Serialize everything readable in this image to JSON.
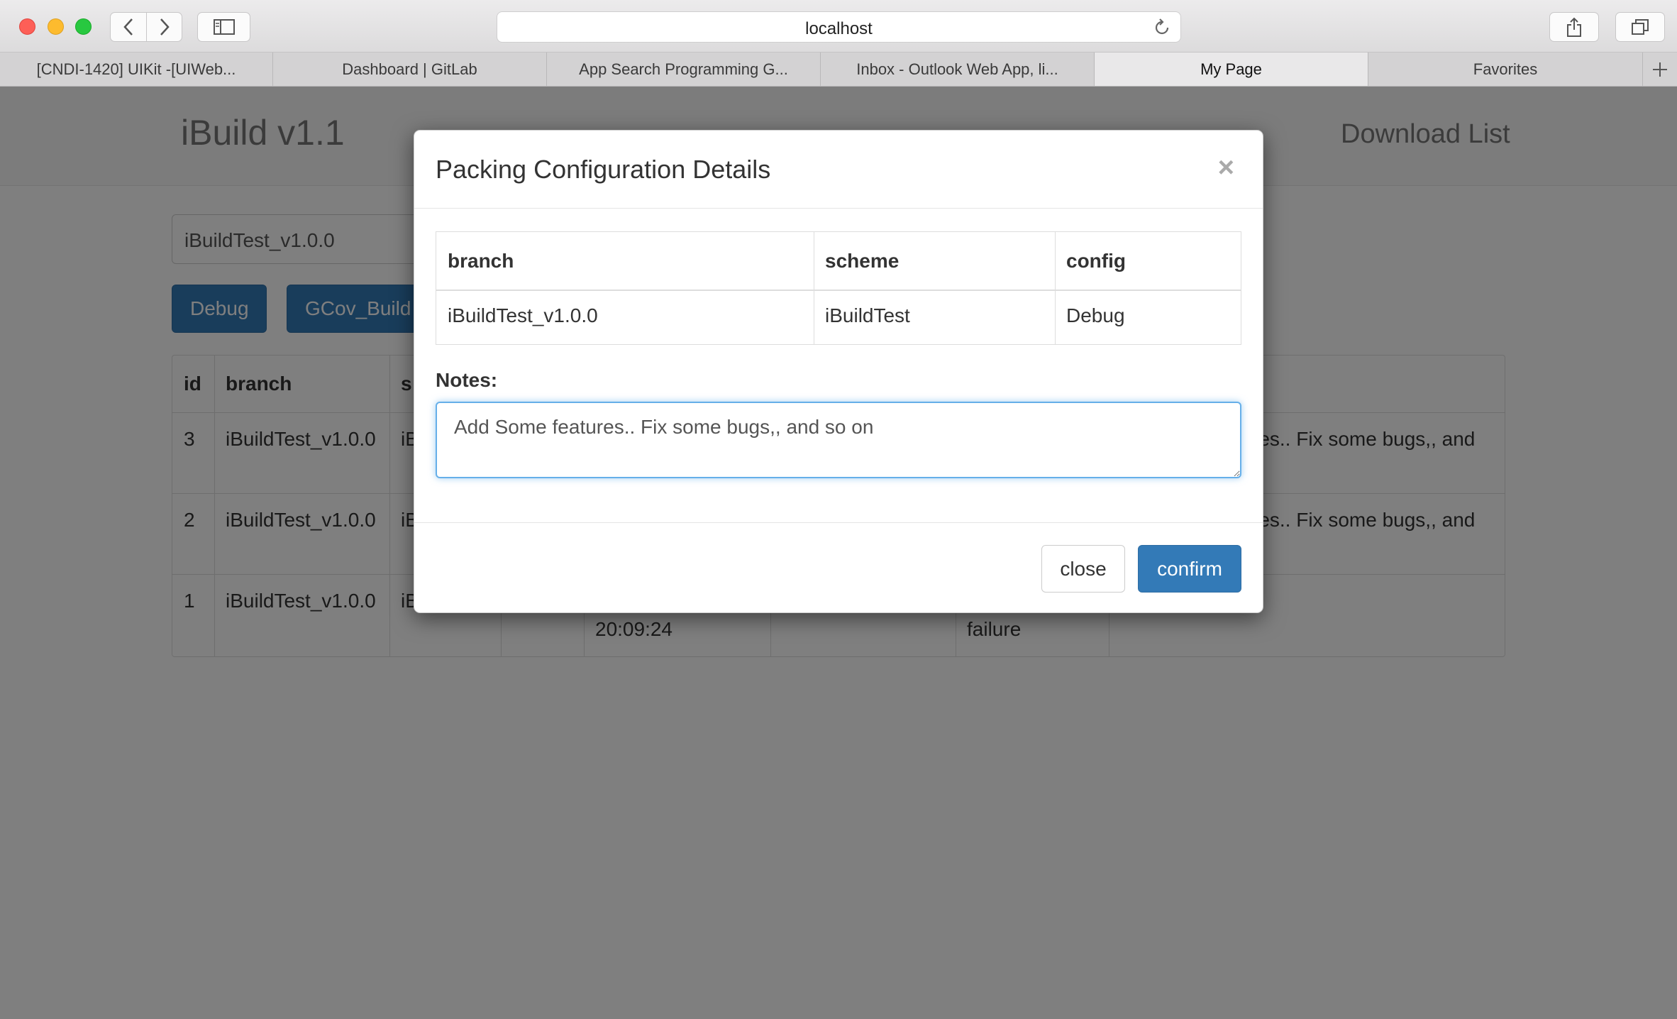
{
  "browser": {
    "url": "localhost",
    "tabs": [
      {
        "label": "[CNDI-1420] UIKit -[UIWeb..."
      },
      {
        "label": "Dashboard | GitLab"
      },
      {
        "label": "App Search Programming G..."
      },
      {
        "label": "Inbox - Outlook Web App, li..."
      },
      {
        "label": "My Page"
      },
      {
        "label": "Favorites"
      }
    ],
    "active_tab": "My Page"
  },
  "page": {
    "brand": "iBuild v1.1",
    "nav_link": "Download List",
    "branch_select_value": "iBuildTest_v1.0.0",
    "buttons": [
      "Debug",
      "GCov_Build"
    ],
    "table": {
      "headers": [
        "id",
        "branch",
        "s"
      ],
      "rows": [
        {
          "id": "3",
          "branch": "iBuildTest_v1.0.0",
          "scheme": "iB",
          "notes": "res.. Fix some bugs,, and"
        },
        {
          "id": "2",
          "branch": "iBuildTest_v1.0.0",
          "scheme": "iB",
          "notes": "res.. Fix some bugs,, and"
        },
        {
          "id": "1",
          "branch": "iBuildTest_v1.0.0",
          "scheme": "iB",
          "time": "20:09:24",
          "status": "failure"
        }
      ]
    }
  },
  "modal": {
    "title": "Packing Configuration Details",
    "close_symbol": "×",
    "config_table": {
      "headers": [
        "branch",
        "scheme",
        "config"
      ],
      "row": [
        "iBuildTest_v1.0.0",
        "iBuildTest",
        "Debug"
      ]
    },
    "notes_label": "Notes:",
    "notes_value": "Add Some features.. Fix some bugs,, and so on",
    "close_button": "close",
    "confirm_button": "confirm"
  },
  "colors": {
    "primary": "#337ab7",
    "focus": "#66afe9",
    "overlay": "rgba(0,0,0,0.5)"
  }
}
